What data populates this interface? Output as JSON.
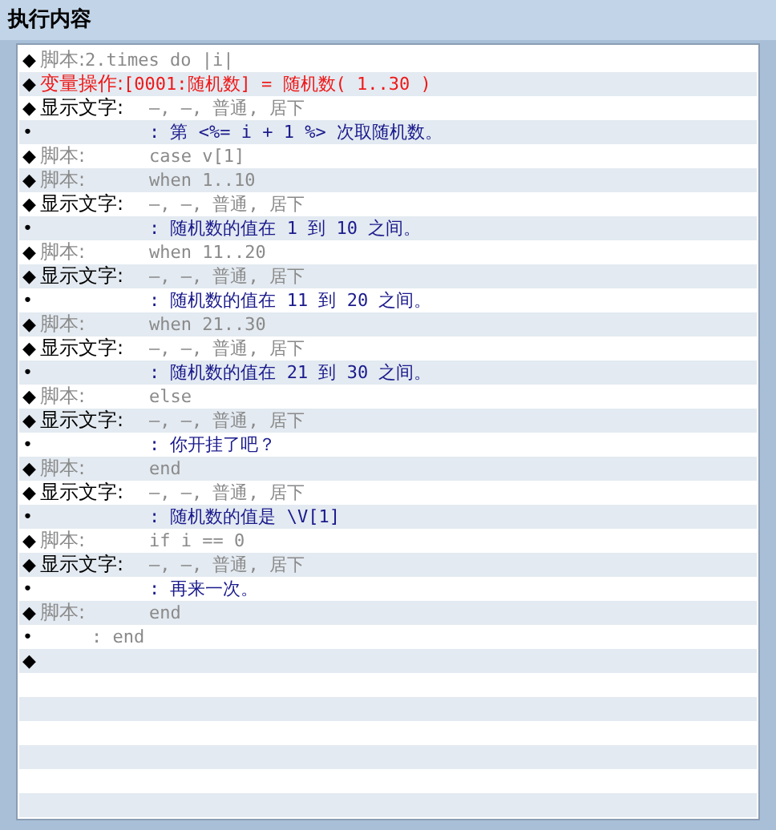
{
  "panel": {
    "title": "执行内容"
  },
  "rows": [
    {
      "kind": "script_inline",
      "marker": "◆",
      "label": "脚本:",
      "value": "2.times do |i|"
    },
    {
      "kind": "variable",
      "marker": "◆",
      "label": "变量操作:",
      "value": "[0001:随机数] = 随机数( 1..30 )"
    },
    {
      "kind": "text_command",
      "marker": "◆",
      "label": "显示文字:",
      "value": "–, –, 普通, 居下"
    },
    {
      "kind": "text_line",
      "marker": "•",
      "value": ": 第 <%= i + 1 %> 次取随机数。"
    },
    {
      "kind": "script",
      "marker": "◆",
      "label": "脚本:",
      "value": "case v[1]"
    },
    {
      "kind": "script",
      "marker": "◆",
      "label": "脚本:",
      "value": "when 1..10"
    },
    {
      "kind": "text_command",
      "marker": "◆",
      "label": "显示文字:",
      "value": "–, –, 普通, 居下"
    },
    {
      "kind": "text_line",
      "marker": "•",
      "value": ": 随机数的值在 1 到 10 之间。"
    },
    {
      "kind": "script",
      "marker": "◆",
      "label": "脚本:",
      "value": "when 11..20"
    },
    {
      "kind": "text_command",
      "marker": "◆",
      "label": "显示文字:",
      "value": "–, –, 普通, 居下"
    },
    {
      "kind": "text_line",
      "marker": "•",
      "value": ": 随机数的值在 11 到 20 之间。"
    },
    {
      "kind": "script",
      "marker": "◆",
      "label": "脚本:",
      "value": "when 21..30"
    },
    {
      "kind": "text_command",
      "marker": "◆",
      "label": "显示文字:",
      "value": "–, –, 普通, 居下"
    },
    {
      "kind": "text_line",
      "marker": "•",
      "value": ": 随机数的值在 21 到 30 之间。"
    },
    {
      "kind": "script",
      "marker": "◆",
      "label": "脚本:",
      "value": "else"
    },
    {
      "kind": "text_command",
      "marker": "◆",
      "label": "显示文字:",
      "value": "–, –, 普通, 居下"
    },
    {
      "kind": "text_line",
      "marker": "•",
      "value": ": 你开挂了吧？"
    },
    {
      "kind": "script",
      "marker": "◆",
      "label": "脚本:",
      "value": "end"
    },
    {
      "kind": "text_command",
      "marker": "◆",
      "label": "显示文字:",
      "value": "–, –, 普通, 居下"
    },
    {
      "kind": "text_line",
      "marker": "•",
      "value": ": 随机数的值是 \\V[1]"
    },
    {
      "kind": "script",
      "marker": "◆",
      "label": "脚本:",
      "value": "if i == 0"
    },
    {
      "kind": "text_command",
      "marker": "◆",
      "label": "显示文字:",
      "value": "–, –, 普通, 居下"
    },
    {
      "kind": "text_line",
      "marker": "•",
      "value": ": 再来一次。"
    },
    {
      "kind": "script",
      "marker": "◆",
      "label": "脚本:",
      "value": "end"
    },
    {
      "kind": "end",
      "marker": "•",
      "value": ": end"
    },
    {
      "kind": "empty",
      "marker": "◆"
    }
  ]
}
